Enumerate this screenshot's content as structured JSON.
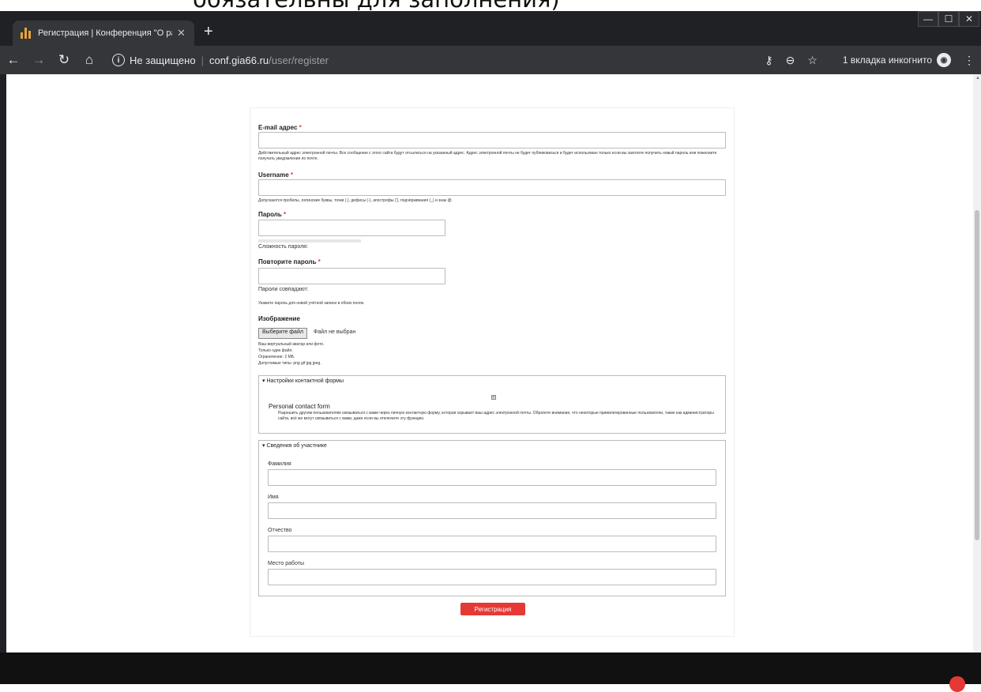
{
  "overlay_caption": "обязательны для заполнения)",
  "browser": {
    "tab_title": "Регистрация | Конференция \"О ра",
    "tab_close": "✕",
    "new_tab": "+",
    "window_controls": [
      "—",
      "☐",
      "✕"
    ],
    "url_insecure": "Не защищено",
    "url_host": "conf.gia66.ru",
    "url_path": "/user/register",
    "incognito_label": "1 вкладка инкогнито",
    "icons": [
      "back-icon",
      "forward-icon",
      "reload-icon",
      "home-icon",
      "info-icon",
      "key-icon",
      "zoom-icon",
      "star-icon",
      "incognito-icon",
      "menu-icon"
    ]
  },
  "form": {
    "email": {
      "label": "E-mail адрес",
      "required_mark": "*",
      "value": "",
      "description": "Действительный адрес электронной почты. Все сообщения с этого сайта будут отсылаться на указанный адрес. Адрес электронной почты не будет публиковаться и будет использован только если вы захотите получить новый пароль или пожелаете получать уведомления по почте."
    },
    "username": {
      "label": "Username",
      "required_mark": "*",
      "value": "",
      "description": "Допускаются пробелы, латинские буквы, точки (.), дефисы (-), апострофы ('), подчёркивания (_) и знак @."
    },
    "password": {
      "label": "Пароль",
      "required_mark": "*",
      "value": "",
      "strength_text": "Сложность пароля:"
    },
    "confirm_password": {
      "label": "Повторите пароль",
      "required_mark": "*",
      "value": "",
      "match_text": "Пароли совпадают:"
    },
    "password_hint": "Укажите пароль для новой учётной записи в обоих полях.",
    "picture": {
      "label": "Изображение",
      "button": "Выберите файл",
      "no_file": "Файл не выбран",
      "notes": [
        "Ваш виртуальный аватар или фото.",
        "Только один файл.",
        "Ограничение: 2 МБ.",
        "Допустимые типы: png gif jpg jpeg."
      ]
    },
    "contact_fieldset": {
      "legend": "▾ Настройки контактной формы",
      "checkbox_label": "Personal contact form",
      "checked": true,
      "description": "Разрешить другим пользователям связываться с вами через личную контактную форму, которая скрывает ваш адрес электронной почты. Обратите внимание, что некоторые привилегированные пользователи, такие как администраторы сайта, всё же могут связываться с вами, даже если вы отключите эту функцию."
    },
    "participant_fieldset": {
      "legend": "▾ Сведения об участнике",
      "fields": [
        {
          "label": "Фамилия",
          "value": ""
        },
        {
          "label": "Имя",
          "value": ""
        },
        {
          "label": "Отчество",
          "value": ""
        },
        {
          "label": "Место работы",
          "value": ""
        }
      ]
    },
    "submit_label": "Регистрация"
  }
}
